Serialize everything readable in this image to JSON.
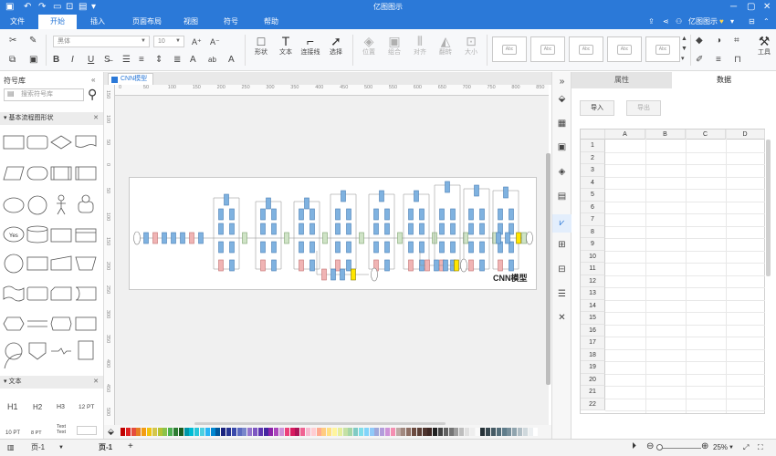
{
  "app": {
    "title": "亿图图示",
    "titlebar_icons": [
      "undo-icon",
      "redo-icon",
      "save-icon",
      "open-icon",
      "print-icon"
    ],
    "window_controls": [
      "minimize-icon",
      "maximize-icon",
      "close-icon"
    ]
  },
  "menu": {
    "tabs": [
      "文件",
      "开始",
      "插入",
      "页面布局",
      "视图",
      "符号",
      "帮助"
    ],
    "active_tab": "开始",
    "user_label": "亿图图示",
    "right_icons": [
      "upload-icon",
      "share-icon",
      "user-icon",
      "expand-icon"
    ]
  },
  "ribbon": {
    "font_family": "黑体",
    "font_size": "10",
    "shape_label": "形状",
    "text_label": "文本",
    "connector_label": "连接线",
    "select_label": "选择",
    "position_label": "位置",
    "group_label": "组合",
    "align_label": "对齐",
    "flip_label": "翻转",
    "size_label": "大小",
    "style_sample": "Abc",
    "tools_label": "工具"
  },
  "left_panel": {
    "title": "符号库",
    "search_placeholder": "搜索符号库",
    "section_flowchart": "基本流程图形状",
    "section_text": "文本",
    "yes_label": "Yes",
    "text_samples": [
      "H1",
      "H2",
      "H3",
      "12 PT",
      "10 PT",
      "8 PT",
      "Text",
      "Text"
    ]
  },
  "document": {
    "tab_name": "CNN模型",
    "diagram_label": "CNN模型"
  },
  "rulers": {
    "horizontal": [
      "0",
      "50",
      "100",
      "150",
      "200",
      "250",
      "300",
      "350",
      "400",
      "450",
      "500",
      "550",
      "600",
      "650",
      "700",
      "750",
      "800",
      "850"
    ],
    "vertical": [
      "150",
      "100",
      "50",
      "0",
      "50",
      "100",
      "150",
      "200",
      "250",
      "300",
      "350",
      "400",
      "450",
      "500"
    ]
  },
  "right_panel": {
    "tab_properties": "属性",
    "tab_data": "数据",
    "import_label": "导入",
    "export_label": "导出",
    "columns": [
      "A",
      "B",
      "C",
      "D"
    ],
    "rows": [
      "1",
      "2",
      "3",
      "4",
      "5",
      "6",
      "7",
      "8",
      "9",
      "10",
      "11",
      "12",
      "13",
      "14",
      "15",
      "16",
      "17",
      "18",
      "19",
      "20",
      "21",
      "22"
    ]
  },
  "status": {
    "page_selector": "页-1",
    "page_tab": "页-1",
    "add_page": "+",
    "zoom": "25%"
  },
  "palette_colors": [
    "#c00000",
    "#e02020",
    "#e64c3c",
    "#e67e22",
    "#f39c12",
    "#f1c40f",
    "#d4c64a",
    "#b5c334",
    "#8bc34a",
    "#4caf50",
    "#2e7d32",
    "#1b5e20",
    "#0097a7",
    "#00bcd4",
    "#26c6da",
    "#4dd0e1",
    "#29b6f6",
    "#0288d1",
    "#01579b",
    "#1a237e",
    "#283593",
    "#3949ab",
    "#5c6bc0",
    "#7986cb",
    "#9575cd",
    "#7e57c2",
    "#5e35b1",
    "#4527a0",
    "#8e24aa",
    "#ab47bc",
    "#ce93d8",
    "#ec407a",
    "#d81b60",
    "#ad1457",
    "#f06292",
    "#f8bbd0",
    "#ffcdd2",
    "#ffab91",
    "#ffcc80",
    "#ffe082",
    "#fff59d",
    "#e6ee9c",
    "#c5e1a5",
    "#a5d6a7",
    "#80cbc4",
    "#80deea",
    "#81d4fa",
    "#90caf9",
    "#9fa8da",
    "#b39ddb",
    "#ce93d8",
    "#f48fb1",
    "#bcaaa4",
    "#a1887f",
    "#8d6e63",
    "#6d4c41",
    "#5d4037",
    "#4e342e",
    "#3e2723",
    "#212121",
    "#424242",
    "#616161",
    "#757575",
    "#9e9e9e",
    "#bdbdbd",
    "#e0e0e0",
    "#eeeeee",
    "#fafafa",
    "#263238",
    "#37474f",
    "#455a64",
    "#546e7a",
    "#607d8b",
    "#78909c",
    "#90a4ae",
    "#b0bec5",
    "#cfd8dc",
    "#eceff1",
    "#ffffff"
  ]
}
